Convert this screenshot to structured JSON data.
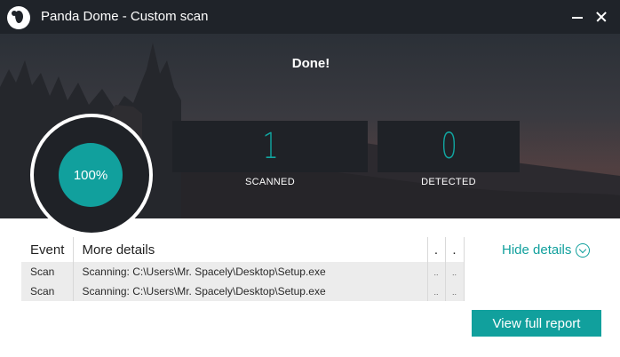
{
  "window": {
    "title": "Panda Dome - Custom scan"
  },
  "scan": {
    "status": "Done!",
    "progress_label": "100%",
    "progress": 100,
    "scanned_value": "1",
    "scanned_label": "SCANNED",
    "detected_value": "0",
    "detected_label": "DETECTED"
  },
  "events": {
    "headers": [
      "Event",
      "More details",
      ".",
      "."
    ],
    "rows": [
      [
        "Scan",
        "Scanning: C:\\Users\\Mr. Spacely\\Desktop\\Setup.exe",
        "..",
        ".."
      ],
      [
        "Scan",
        "Scanning: C:\\Users\\Mr. Spacely\\Desktop\\Setup.exe",
        "..",
        ".."
      ]
    ]
  },
  "actions": {
    "hide_details": "Hide details",
    "view_report": "View full report"
  },
  "colors": {
    "accent": "#11a09d",
    "titlebar": "#1f2329",
    "panel": "#1f2227"
  }
}
